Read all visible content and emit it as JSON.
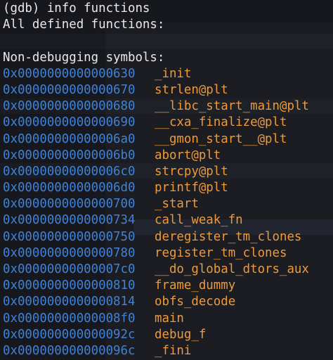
{
  "terminal": {
    "prompt_line": "(gdb) info functions",
    "header": "All defined functions:",
    "section_title": "Non-debugging symbols:",
    "symbols": [
      {
        "addr": "0x0000000000000630",
        "name": "_init"
      },
      {
        "addr": "0x0000000000000670",
        "name": "strlen@plt"
      },
      {
        "addr": "0x0000000000000680",
        "name": "__libc_start_main@plt"
      },
      {
        "addr": "0x0000000000000690",
        "name": "__cxa_finalize@plt"
      },
      {
        "addr": "0x00000000000006a0",
        "name": "__gmon_start__@plt"
      },
      {
        "addr": "0x00000000000006b0",
        "name": "abort@plt"
      },
      {
        "addr": "0x00000000000006c0",
        "name": "strcpy@plt"
      },
      {
        "addr": "0x00000000000006d0",
        "name": "printf@plt"
      },
      {
        "addr": "0x0000000000000700",
        "name": "_start"
      },
      {
        "addr": "0x0000000000000734",
        "name": "call_weak_fn"
      },
      {
        "addr": "0x0000000000000750",
        "name": "deregister_tm_clones"
      },
      {
        "addr": "0x0000000000000780",
        "name": "register_tm_clones"
      },
      {
        "addr": "0x00000000000007c0",
        "name": "__do_global_dtors_aux"
      },
      {
        "addr": "0x0000000000000810",
        "name": "frame_dummy"
      },
      {
        "addr": "0x0000000000000814",
        "name": "obfs_decode"
      },
      {
        "addr": "0x00000000000008f0",
        "name": "main"
      },
      {
        "addr": "0x000000000000092c",
        "name": "debug_f"
      },
      {
        "addr": "0x000000000000096c",
        "name": "_fini"
      }
    ]
  },
  "colors": {
    "background": "#16181e",
    "address": "#3f82d8",
    "symbol": "#ee9a3a",
    "text": "#e9e9ea"
  }
}
